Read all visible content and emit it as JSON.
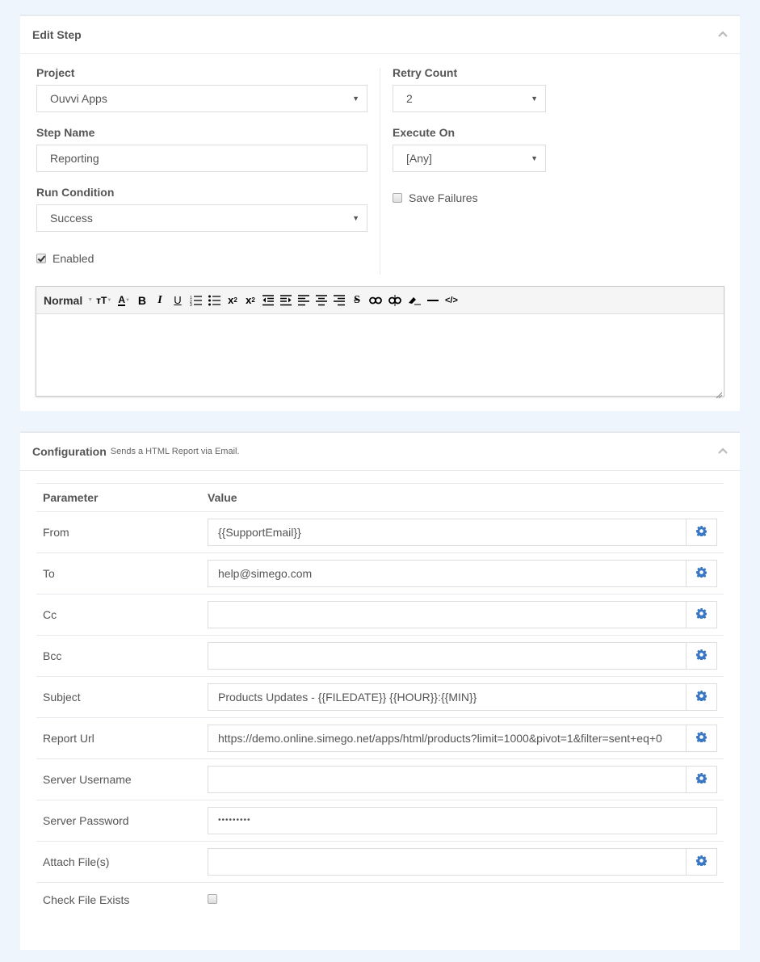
{
  "edit_step": {
    "title": "Edit Step",
    "project": {
      "label": "Project",
      "value": "Ouvvi Apps"
    },
    "step_name": {
      "label": "Step Name",
      "value": "Reporting"
    },
    "run_condition": {
      "label": "Run Condition",
      "value": "Success"
    },
    "enabled": {
      "label": "Enabled",
      "checked": true
    },
    "retry_count": {
      "label": "Retry Count",
      "value": "2"
    },
    "execute_on": {
      "label": "Execute On",
      "value": "[Any]"
    },
    "save_failures": {
      "label": "Save Failures",
      "checked": false
    },
    "editor": {
      "format_label": "Normal",
      "toolbar_icons": [
        "font-size-icon",
        "font-color-icon",
        "bold-icon",
        "italic-icon",
        "underline-icon",
        "ordered-list-icon",
        "unordered-list-icon",
        "subscript-icon",
        "superscript-icon",
        "outdent-icon",
        "indent-icon",
        "align-left-icon",
        "align-center-icon",
        "align-right-icon",
        "strikethrough-icon",
        "link-icon",
        "unlink-icon",
        "clear-format-icon",
        "horizontal-rule-icon",
        "source-code-icon"
      ],
      "content": ""
    }
  },
  "configuration": {
    "title": "Configuration",
    "subtitle": "Sends a HTML Report via Email.",
    "columns": [
      "Parameter",
      "Value"
    ],
    "rows": [
      {
        "name": "From",
        "value": "{{SupportEmail}}",
        "has_gear": true
      },
      {
        "name": "To",
        "value": "help@simego.com",
        "has_gear": true
      },
      {
        "name": "Cc",
        "value": "",
        "has_gear": true
      },
      {
        "name": "Bcc",
        "value": "",
        "has_gear": true
      },
      {
        "name": "Subject",
        "value": "Products Updates - {{FILEDATE}} {{HOUR}}:{{MIN}}",
        "has_gear": true
      },
      {
        "name": "Report Url",
        "value": "https://demo.online.simego.net/apps/html/products?limit=1000&pivot=1&filter=sent+eq+0",
        "has_gear": true
      },
      {
        "name": "Server Username",
        "value": "",
        "has_gear": true
      },
      {
        "name": "Server Password",
        "value": "•••••••••",
        "has_gear": false
      },
      {
        "name": "Attach File(s)",
        "value": "",
        "has_gear": true
      }
    ],
    "check_file_exists": {
      "label": "Check File Exists",
      "checked": false
    }
  },
  "colors": {
    "accent": "#3a78c3",
    "background": "#eef5fc",
    "border": "#dddddd"
  }
}
